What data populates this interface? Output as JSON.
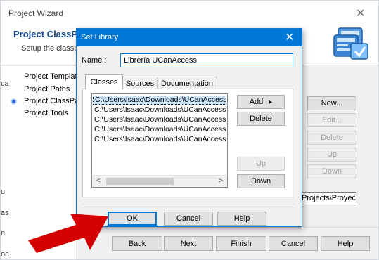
{
  "wizard": {
    "title": "Project Wizard",
    "close_glyph": "✕",
    "heading": "Project ClassP",
    "subtitle": "Setup the classpa",
    "logo_icon": "project-library-icon",
    "nav_items": [
      "Project Template",
      "Project Paths",
      "Project ClassPat",
      "Project Tools"
    ],
    "left_cut_texts": [
      "ca",
      "u",
      "as",
      "n",
      "oc"
    ],
    "right_buttons": {
      "new": "New...",
      "edit": "Edit...",
      "delete": "Delete",
      "up": "Up",
      "down": "Down"
    },
    "path_value": "Projects\\Proyect",
    "footer_buttons": {
      "back": "Back",
      "next": "Next",
      "finish": "Finish",
      "cancel": "Cancel",
      "help": "Help"
    }
  },
  "dialog": {
    "title": "Set Library",
    "close_glyph": "✕",
    "name_label": "Name :",
    "name_value": "Librería UCanAccess",
    "tabs": [
      "Classes",
      "Sources",
      "Documentation"
    ],
    "active_tab": "Classes",
    "classes": [
      "C:\\Users\\Isaac\\Downloads\\UCanAccess",
      "C:\\Users\\Isaac\\Downloads\\UCanAccess",
      "C:\\Users\\Isaac\\Downloads\\UCanAccess",
      "C:\\Users\\Isaac\\Downloads\\UCanAccess",
      "C:\\Users\\Isaac\\Downloads\\UCanAccess"
    ],
    "selected_class_index": 0,
    "buttons": {
      "add": "Add",
      "add_arrow": "▸",
      "delete": "Delete",
      "up": "Up",
      "down": "Down",
      "ok": "OK",
      "cancel": "Cancel",
      "help": "Help"
    },
    "scroll_left_glyph": "<",
    "scroll_right_glyph": ">"
  },
  "colors": {
    "accent": "#0078d7",
    "heading": "#1a4b8c",
    "selection": "#cce8ff",
    "arrow": "#d40000"
  }
}
